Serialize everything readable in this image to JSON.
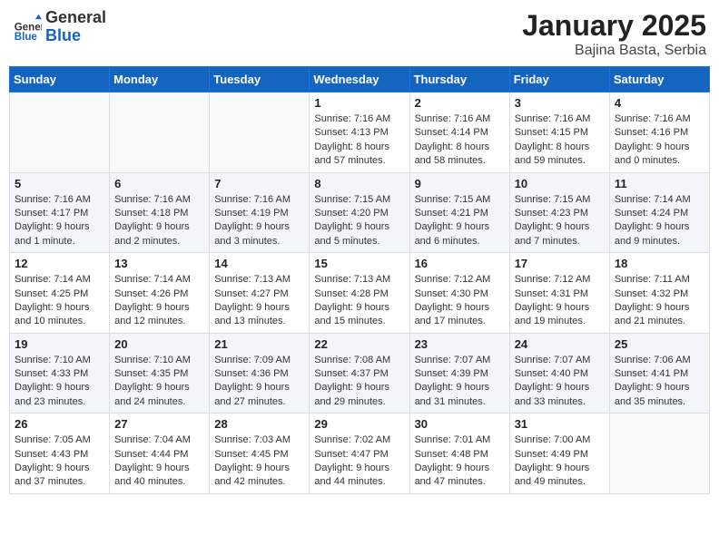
{
  "header": {
    "logo_general": "General",
    "logo_blue": "Blue",
    "month_title": "January 2025",
    "location": "Bajina Basta, Serbia"
  },
  "weekdays": [
    "Sunday",
    "Monday",
    "Tuesday",
    "Wednesday",
    "Thursday",
    "Friday",
    "Saturday"
  ],
  "weeks": [
    [
      {
        "num": "",
        "info": ""
      },
      {
        "num": "",
        "info": ""
      },
      {
        "num": "",
        "info": ""
      },
      {
        "num": "1",
        "info": "Sunrise: 7:16 AM\nSunset: 4:13 PM\nDaylight: 8 hours and 57 minutes."
      },
      {
        "num": "2",
        "info": "Sunrise: 7:16 AM\nSunset: 4:14 PM\nDaylight: 8 hours and 58 minutes."
      },
      {
        "num": "3",
        "info": "Sunrise: 7:16 AM\nSunset: 4:15 PM\nDaylight: 8 hours and 59 minutes."
      },
      {
        "num": "4",
        "info": "Sunrise: 7:16 AM\nSunset: 4:16 PM\nDaylight: 9 hours and 0 minutes."
      }
    ],
    [
      {
        "num": "5",
        "info": "Sunrise: 7:16 AM\nSunset: 4:17 PM\nDaylight: 9 hours and 1 minute."
      },
      {
        "num": "6",
        "info": "Sunrise: 7:16 AM\nSunset: 4:18 PM\nDaylight: 9 hours and 2 minutes."
      },
      {
        "num": "7",
        "info": "Sunrise: 7:16 AM\nSunset: 4:19 PM\nDaylight: 9 hours and 3 minutes."
      },
      {
        "num": "8",
        "info": "Sunrise: 7:15 AM\nSunset: 4:20 PM\nDaylight: 9 hours and 5 minutes."
      },
      {
        "num": "9",
        "info": "Sunrise: 7:15 AM\nSunset: 4:21 PM\nDaylight: 9 hours and 6 minutes."
      },
      {
        "num": "10",
        "info": "Sunrise: 7:15 AM\nSunset: 4:23 PM\nDaylight: 9 hours and 7 minutes."
      },
      {
        "num": "11",
        "info": "Sunrise: 7:14 AM\nSunset: 4:24 PM\nDaylight: 9 hours and 9 minutes."
      }
    ],
    [
      {
        "num": "12",
        "info": "Sunrise: 7:14 AM\nSunset: 4:25 PM\nDaylight: 9 hours and 10 minutes."
      },
      {
        "num": "13",
        "info": "Sunrise: 7:14 AM\nSunset: 4:26 PM\nDaylight: 9 hours and 12 minutes."
      },
      {
        "num": "14",
        "info": "Sunrise: 7:13 AM\nSunset: 4:27 PM\nDaylight: 9 hours and 13 minutes."
      },
      {
        "num": "15",
        "info": "Sunrise: 7:13 AM\nSunset: 4:28 PM\nDaylight: 9 hours and 15 minutes."
      },
      {
        "num": "16",
        "info": "Sunrise: 7:12 AM\nSunset: 4:30 PM\nDaylight: 9 hours and 17 minutes."
      },
      {
        "num": "17",
        "info": "Sunrise: 7:12 AM\nSunset: 4:31 PM\nDaylight: 9 hours and 19 minutes."
      },
      {
        "num": "18",
        "info": "Sunrise: 7:11 AM\nSunset: 4:32 PM\nDaylight: 9 hours and 21 minutes."
      }
    ],
    [
      {
        "num": "19",
        "info": "Sunrise: 7:10 AM\nSunset: 4:33 PM\nDaylight: 9 hours and 23 minutes."
      },
      {
        "num": "20",
        "info": "Sunrise: 7:10 AM\nSunset: 4:35 PM\nDaylight: 9 hours and 24 minutes."
      },
      {
        "num": "21",
        "info": "Sunrise: 7:09 AM\nSunset: 4:36 PM\nDaylight: 9 hours and 27 minutes."
      },
      {
        "num": "22",
        "info": "Sunrise: 7:08 AM\nSunset: 4:37 PM\nDaylight: 9 hours and 29 minutes."
      },
      {
        "num": "23",
        "info": "Sunrise: 7:07 AM\nSunset: 4:39 PM\nDaylight: 9 hours and 31 minutes."
      },
      {
        "num": "24",
        "info": "Sunrise: 7:07 AM\nSunset: 4:40 PM\nDaylight: 9 hours and 33 minutes."
      },
      {
        "num": "25",
        "info": "Sunrise: 7:06 AM\nSunset: 4:41 PM\nDaylight: 9 hours and 35 minutes."
      }
    ],
    [
      {
        "num": "26",
        "info": "Sunrise: 7:05 AM\nSunset: 4:43 PM\nDaylight: 9 hours and 37 minutes."
      },
      {
        "num": "27",
        "info": "Sunrise: 7:04 AM\nSunset: 4:44 PM\nDaylight: 9 hours and 40 minutes."
      },
      {
        "num": "28",
        "info": "Sunrise: 7:03 AM\nSunset: 4:45 PM\nDaylight: 9 hours and 42 minutes."
      },
      {
        "num": "29",
        "info": "Sunrise: 7:02 AM\nSunset: 4:47 PM\nDaylight: 9 hours and 44 minutes."
      },
      {
        "num": "30",
        "info": "Sunrise: 7:01 AM\nSunset: 4:48 PM\nDaylight: 9 hours and 47 minutes."
      },
      {
        "num": "31",
        "info": "Sunrise: 7:00 AM\nSunset: 4:49 PM\nDaylight: 9 hours and 49 minutes."
      },
      {
        "num": "",
        "info": ""
      }
    ]
  ]
}
